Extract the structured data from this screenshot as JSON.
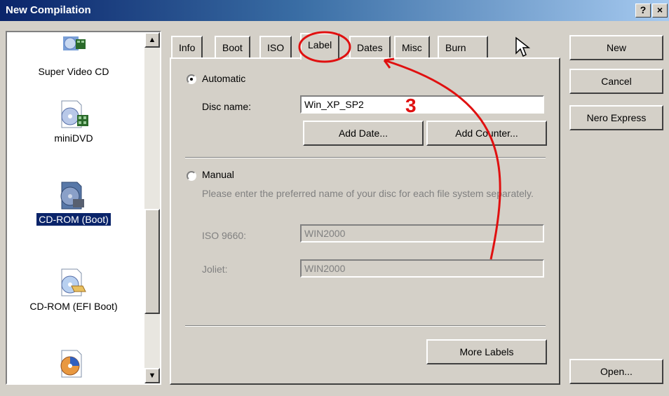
{
  "window": {
    "title": "New Compilation",
    "help_glyph": "?",
    "close_glyph": "×"
  },
  "compilations": [
    {
      "label": "Super Video CD",
      "icon": "super-video-cd-icon",
      "selected": false
    },
    {
      "label": "miniDVD",
      "icon": "minidvd-icon",
      "selected": false
    },
    {
      "label": "CD-ROM (Boot)",
      "icon": "cd-rom-boot-icon",
      "selected": true
    },
    {
      "label": "CD-ROM (EFI Boot)",
      "icon": "cd-rom-efi-boot-icon",
      "selected": false
    }
  ],
  "tabs": [
    {
      "label": "Info"
    },
    {
      "label": "Boot"
    },
    {
      "label": "ISO"
    },
    {
      "label": "Label",
      "active": true
    },
    {
      "label": "Dates"
    },
    {
      "label": "Misc"
    },
    {
      "label": "Burn"
    }
  ],
  "label_tab": {
    "automatic_label": "Automatic",
    "disc_name_label": "Disc name:",
    "disc_name_value": "Win_XP_SP2",
    "add_date": "Add Date...",
    "add_counter": "Add Counter...",
    "manual_label": "Manual",
    "manual_hint": "Please enter the preferred name of your disc for each file system separately.",
    "iso9660_label": "ISO 9660:",
    "iso9660_value": "WIN2000",
    "joliet_label": "Joliet:",
    "joliet_value": "WIN2000",
    "more_labels": "More Labels"
  },
  "side_buttons": {
    "new": "New",
    "cancel": "Cancel",
    "nero_express": "Nero Express",
    "open": "Open..."
  },
  "annotation": {
    "step_number": "3",
    "color": "#e01010"
  },
  "colors": {
    "titlebar": "#0a246a",
    "face": "#d4d0c8",
    "selection": "#0a246a"
  }
}
